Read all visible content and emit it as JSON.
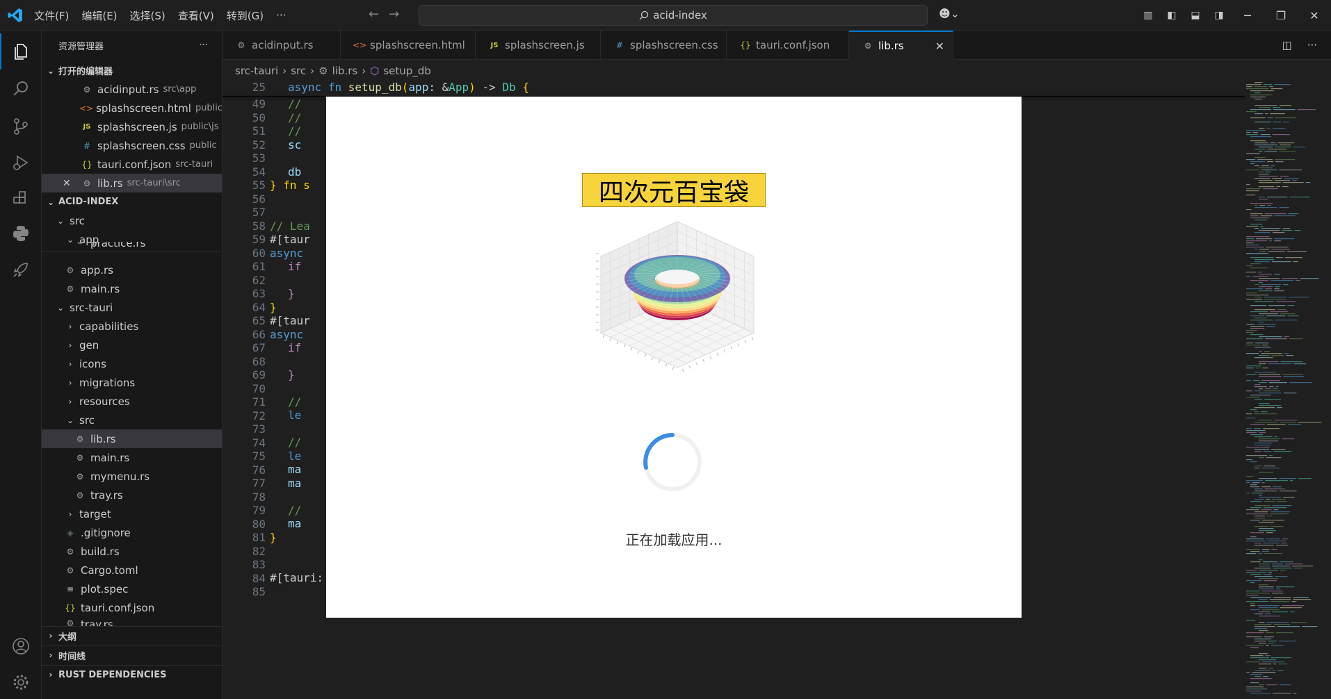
{
  "titlebar": {
    "menu": [
      "文件(F)",
      "编辑(E)",
      "选择(S)",
      "查看(V)",
      "转到(G)",
      "···"
    ],
    "search_text": "acid-index"
  },
  "sidebar": {
    "header": "资源管理器",
    "open_editors_label": "打开的编辑器",
    "open_editors": [
      {
        "name": "acidinput.rs",
        "desc": "src\\app"
      },
      {
        "name": "splashscreen.html",
        "desc": "public"
      },
      {
        "name": "splashscreen.js",
        "desc": "public\\js"
      },
      {
        "name": "splashscreen.css",
        "desc": "public"
      },
      {
        "name": "tauri.conf.json",
        "desc": "src-tauri"
      },
      {
        "name": "lib.rs",
        "desc": "src-tauri\\src"
      }
    ],
    "project_label": "ACID-INDEX",
    "tree": {
      "src": "src",
      "app": "app",
      "practice": "practice.rs",
      "app_rs": "app.rs",
      "main_rs": "main.rs",
      "src_tauri": "src-tauri",
      "capabilities": "capabilities",
      "gen": "gen",
      "icons": "icons",
      "migrations": "migrations",
      "resources": "resources",
      "src2": "src",
      "lib_rs": "lib.rs",
      "main_rs2": "main.rs",
      "mymenu_rs": "mymenu.rs",
      "tray_rs": "tray.rs",
      "target": "target",
      "gitignore": ".gitignore",
      "build_rs": "build.rs",
      "cargo": "Cargo.toml",
      "plot_spec": "plot.spec",
      "tauri_conf": "tauri.conf.json",
      "tray_rs2": "tray.rs"
    },
    "outline": "大纲",
    "timeline": "时间线",
    "rust_deps": "RUST DEPENDENCIES"
  },
  "tabs": [
    "acidinput.rs",
    "splashscreen.html",
    "splashscreen.js",
    "splashscreen.css",
    "tauri.conf.json",
    "lib.rs"
  ],
  "breadcrumb": [
    "src-tauri",
    "src",
    "lib.rs",
    "setup_db"
  ],
  "editor": {
    "sticky_line": "25",
    "lines": [
      "49",
      "50",
      "51",
      "52",
      "53",
      "54",
      "55",
      "56",
      "57",
      "58",
      "59",
      "60",
      "61",
      "62",
      "63",
      "64",
      "65",
      "66",
      "67",
      "68",
      "69",
      "70",
      "71",
      "72",
      "73",
      "74",
      "75",
      "76",
      "77",
      "78",
      "79",
      "80",
      "81",
      "82",
      "83",
      "84",
      "85"
    ],
    "code": {
      "l55_a": "} fn s",
      "l58": "// Lea",
      "l59": "#[taur",
      "l60": "async ",
      "l61": "if",
      "l63": "}",
      "l64": "}",
      "l65": "#[taur",
      "l66": "async ",
      "l67": "if",
      "l69": "}",
      "l71": "//",
      "l72": "le",
      "l74": "//",
      "l75": "le",
      "l76": "ma",
      "l77": "ma",
      "l79": "//",
      "l80": "ma",
      "l81": "}",
      "l85": "#[tauri::command]",
      "l49": "//",
      "l50": "//",
      "l51": "//",
      "l52": "sc",
      "l54": "db"
    }
  },
  "splash": {
    "title": "四次元百宝袋",
    "loading_text": "正在加载应用..."
  }
}
